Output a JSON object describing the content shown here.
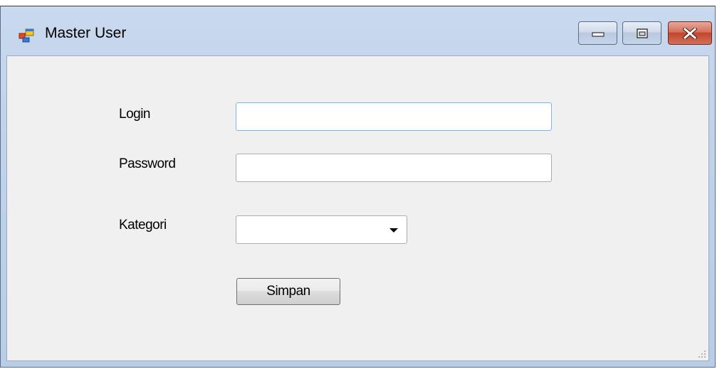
{
  "window": {
    "title": "Master User"
  },
  "form": {
    "login_label": "Login",
    "login_value": "",
    "password_label": "Password",
    "password_value": "",
    "kategori_label": "Kategori",
    "kategori_value": "",
    "simpan_label": "Simpan"
  },
  "icons": {
    "app": "form-window-icon",
    "minimize": "minimize-icon",
    "maximize": "maximize-icon",
    "close": "close-icon",
    "dropdown": "chevron-down-icon",
    "grip": "resize-grip-icon"
  },
  "colors": {
    "titlebar": "#bfd2ea",
    "client_bg": "#f0f0f0",
    "close_button": "#c2452c",
    "focus_border": "#7eb4ea"
  }
}
